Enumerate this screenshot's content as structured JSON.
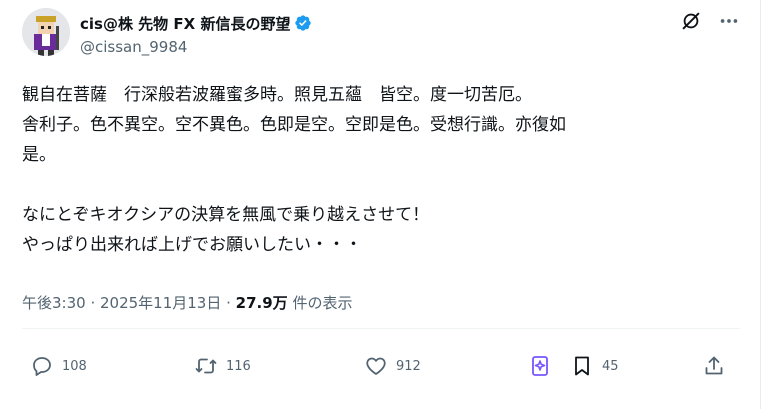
{
  "author": {
    "display_name": "cis@株 先物 FX 新信長の野望",
    "handle": "@cissan_9984",
    "verified": true,
    "avatar_icon": "pixel-art-character-avatar"
  },
  "header_actions": {
    "grok_icon": "grok-icon",
    "more_icon": "more-icon"
  },
  "post": {
    "text": "観自在菩薩　行深般若波羅蜜多時。照見五蘊　皆空。度一切苦厄。\n舎利子。色不異空。空不異色。色即是空。空即是色。受想行識。亦復如\n是。\n\nなにとぞキオクシアの決算を無風で乗り越えさせて！\nやっぱり出来れば上げでお願いしたい・・・"
  },
  "meta": {
    "time": "午後3:30",
    "sep1": " · ",
    "date": "2025年11月13日",
    "sep2": " · ",
    "views": "27.9万",
    "views_label": " 件の表示"
  },
  "actions": {
    "reply_count": "108",
    "repost_count": "116",
    "like_count": "912",
    "bookmark_count": "45"
  },
  "colors": {
    "text": "#0f1419",
    "secondary": "#536471",
    "verified": "#1d9bf0",
    "grok_purple": "#7856ff"
  }
}
